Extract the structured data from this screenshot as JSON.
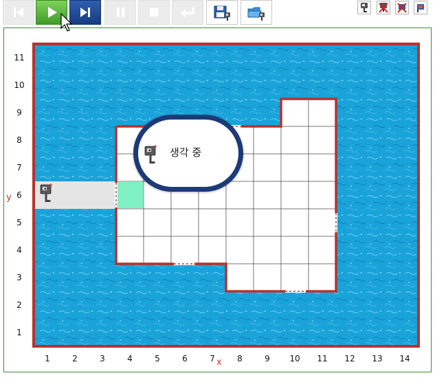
{
  "toolbar": {
    "buttons": [
      {
        "name": "skip-back-button",
        "icon": "skip-back-icon",
        "state": "disabled"
      },
      {
        "name": "play-button",
        "icon": "play-icon",
        "state": "active-green"
      },
      {
        "name": "step-forward-button",
        "icon": "step-forward-icon",
        "state": "active-blue"
      },
      {
        "name": "pause-button",
        "icon": "pause-icon",
        "state": "disabled"
      },
      {
        "name": "stop-button",
        "icon": "stop-icon",
        "state": "disabled"
      },
      {
        "name": "return-button",
        "icon": "return-icon",
        "state": "disabled"
      },
      {
        "name": "save-robot-button",
        "icon": "floppy-robot-icon",
        "state": "enabled"
      },
      {
        "name": "open-robot-button",
        "icon": "folder-robot-icon",
        "state": "enabled"
      }
    ],
    "right_icons": [
      "robot-icon",
      "robot-delete-icon",
      "flag-delete-icon",
      "flag-icon"
    ]
  },
  "grid": {
    "columns": 14,
    "rows": 11,
    "x_labels": [
      "1",
      "2",
      "3",
      "4",
      "5",
      "6",
      "7",
      "8",
      "9",
      "10",
      "11",
      "12",
      "13",
      "14"
    ],
    "y_labels": [
      "11",
      "10",
      "9",
      "8",
      "7",
      "6",
      "5",
      "4",
      "3",
      "2",
      "1"
    ],
    "x_axis_name": "x",
    "y_axis_name": "y",
    "colors": {
      "water": "#1aa3d9",
      "border": "#b5332d",
      "floor": "#ffffff",
      "goal": "#7ff0c3",
      "path": "#e5e5e5",
      "grid_line": "#555555"
    }
  },
  "robots": [
    {
      "name": "robot-start",
      "cell": {
        "x": 1,
        "y": 6
      }
    },
    {
      "name": "robot-thinking",
      "cell": {
        "x": 5,
        "y": 7
      }
    }
  ],
  "goal_cell": {
    "x": 4,
    "y": 6
  },
  "bubble": {
    "text": "생각 중"
  }
}
